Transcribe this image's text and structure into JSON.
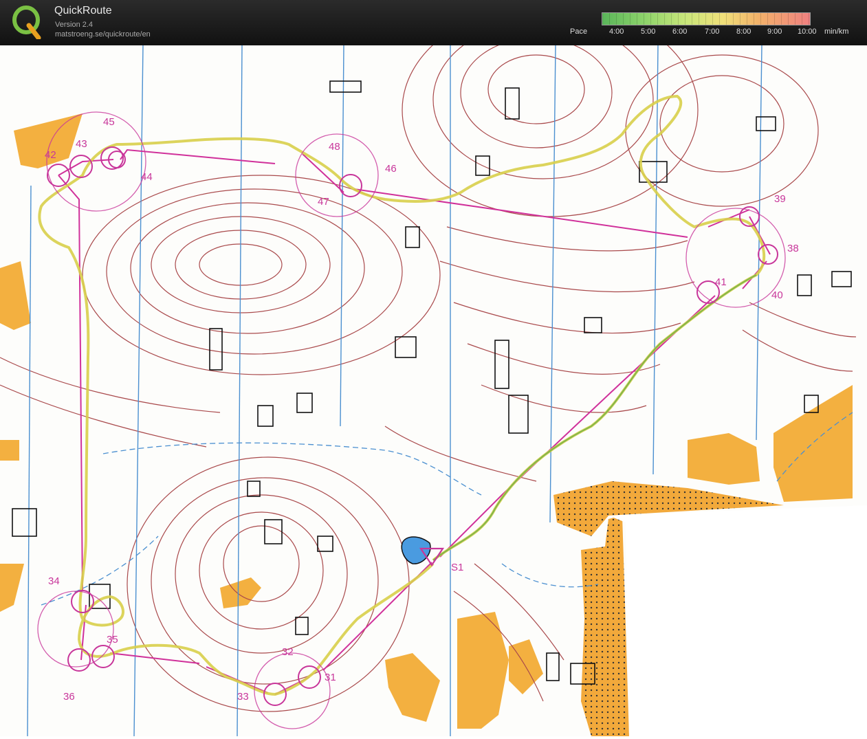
{
  "app": {
    "title": "QuickRoute",
    "version": "Version 2.4",
    "url": "matstroeng.se/quickroute/en",
    "logo_letter": "Q"
  },
  "pace_scale": {
    "label": "Pace",
    "ticks": [
      "4:00",
      "5:00",
      "6:00",
      "7:00",
      "8:00",
      "9:00",
      "10:00"
    ],
    "unit": "min/km",
    "colors": {
      "fast": "#5ab55a",
      "medium": "#f0e07a",
      "slow": "#f08080"
    }
  },
  "map": {
    "route_color": "#d8cf4a",
    "course_color": "#d0309a",
    "contour_color": "#9a3a3a",
    "controls": [
      "45",
      "43",
      "42",
      "44",
      "48",
      "46",
      "47",
      "39",
      "38",
      "41",
      "40",
      "S1",
      "34",
      "35",
      "36",
      "32",
      "31",
      "33"
    ]
  }
}
